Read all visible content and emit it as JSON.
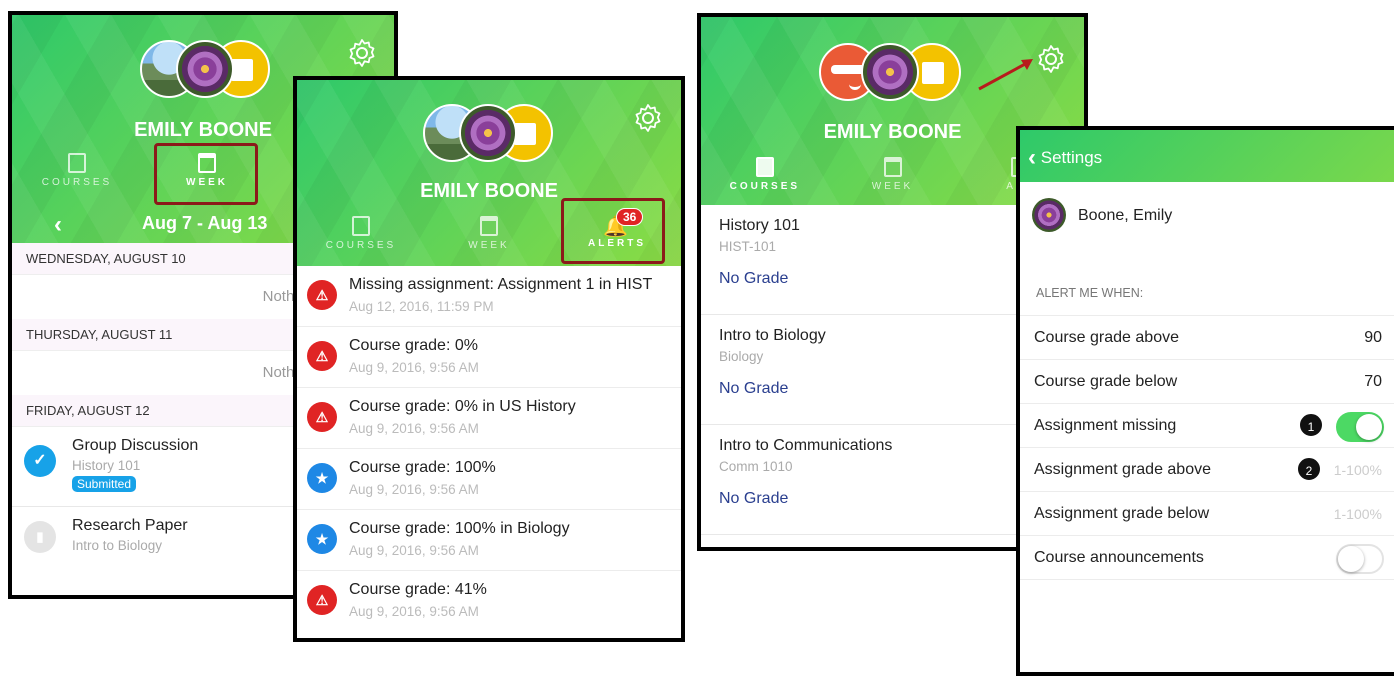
{
  "screen1": {
    "name": "EMILY BOONE",
    "tabs": [
      "COURSES",
      "WEEK"
    ],
    "date_range": "Aug 7 - Aug 13",
    "days": [
      {
        "label": "WEDNESDAY, AUGUST 10",
        "empty": "Nothing Due"
      },
      {
        "label": "THURSDAY, AUGUST 11",
        "empty": "Nothing Due"
      },
      {
        "label": "FRIDAY, AUGUST 12"
      }
    ],
    "items": [
      {
        "title": "Group Discussion",
        "course": "History 101",
        "badge": "Submitted"
      },
      {
        "title": "Research Paper",
        "course": "Intro to Biology"
      }
    ]
  },
  "screen2": {
    "name": "EMILY BOONE",
    "tabs": [
      "COURSES",
      "WEEK",
      "ALERTS"
    ],
    "alert_count": "36",
    "alerts": [
      {
        "title": "Missing assignment: Assignment 1 in HIST",
        "date": "Aug 12, 2016, 11:59 PM",
        "kind": "warning"
      },
      {
        "title": "Course grade: 0%",
        "date": "Aug 9, 2016, 9:56 AM",
        "kind": "warning"
      },
      {
        "title": "Course grade: 0% in US History",
        "date": "Aug 9, 2016, 9:56 AM",
        "kind": "warning"
      },
      {
        "title": "Course grade: 100%",
        "date": "Aug 9, 2016, 9:56 AM",
        "kind": "star"
      },
      {
        "title": "Course grade: 100% in Biology",
        "date": "Aug 9, 2016, 9:56 AM",
        "kind": "star"
      },
      {
        "title": "Course grade: 41%",
        "date": "Aug 9, 2016, 9:56 AM",
        "kind": "warning"
      }
    ]
  },
  "screen3": {
    "name": "EMILY BOONE",
    "tabs": [
      "COURSES",
      "WEEK",
      "ALE"
    ],
    "courses": [
      {
        "title": "History 101",
        "code": "HIST-101",
        "grade": "No Grade"
      },
      {
        "title": "Intro to Biology",
        "code": "Biology",
        "grade": "No Grade"
      },
      {
        "title": "Intro to Communications",
        "code": "Comm 1010",
        "grade": "No Grade"
      }
    ]
  },
  "screen4": {
    "back_label": "Settings",
    "student": "Boone, Emily",
    "section_label": "ALERT ME WHEN:",
    "rows": [
      {
        "label": "Course grade above",
        "value": "90"
      },
      {
        "label": "Course grade below",
        "value": "70"
      },
      {
        "label": "Assignment missing",
        "toggle": "on"
      },
      {
        "label": "Assignment grade above",
        "value": "1-100%"
      },
      {
        "label": "Assignment grade below",
        "value": "1-100%"
      },
      {
        "label": "Course announcements",
        "toggle": "off"
      }
    ],
    "markers": [
      "1",
      "2"
    ]
  },
  "colors": {
    "accent_red": "#8b1a1a",
    "alert_red": "#e02424",
    "star_blue": "#1e88e5",
    "toggle_green": "#4cd964",
    "link_blue": "#2a3f8f"
  }
}
